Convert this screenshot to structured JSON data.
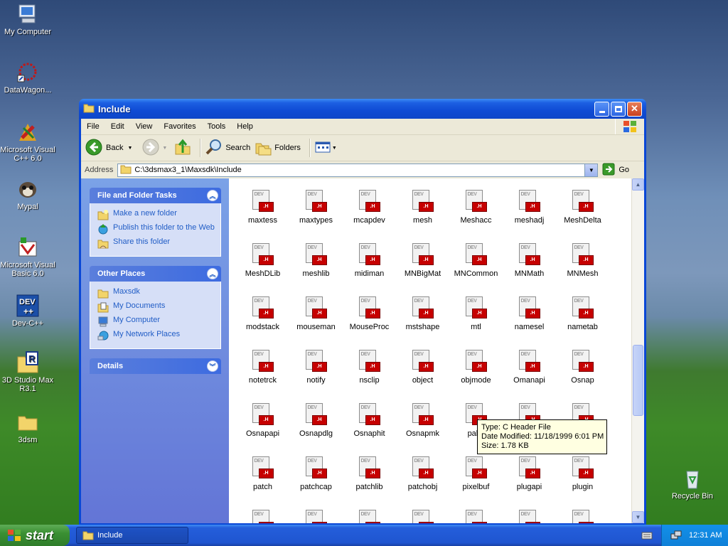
{
  "desktop": {
    "icons": [
      {
        "label": "My Computer"
      },
      {
        "label": "DataWagon..."
      },
      {
        "label": "Microsoft Visual C++ 6.0"
      },
      {
        "label": "Mypal"
      },
      {
        "label": "Microsoft Visual Basic 6.0"
      },
      {
        "label": "Dev-C++"
      },
      {
        "label": "3D Studio Max R3.1"
      },
      {
        "label": "3dsm"
      },
      {
        "label": "Recycle Bin"
      }
    ]
  },
  "window": {
    "title": "Include",
    "menu": [
      "File",
      "Edit",
      "View",
      "Favorites",
      "Tools",
      "Help"
    ],
    "toolbar": {
      "back": "Back",
      "search": "Search",
      "folders": "Folders"
    },
    "address": {
      "label": "Address",
      "path": "C:\\3dsmax3_1\\Maxsdk\\Include",
      "go": "Go"
    },
    "tasks": {
      "file_folder_tasks": {
        "title": "File and Folder Tasks",
        "items": [
          "Make a new folder",
          "Publish this folder to the Web",
          "Share this folder"
        ]
      },
      "other_places": {
        "title": "Other Places",
        "items": [
          "Maxsdk",
          "My Documents",
          "My Computer",
          "My Network Places"
        ]
      },
      "details": {
        "title": "Details"
      }
    },
    "files": [
      "maxtess",
      "maxtypes",
      "mcapdev",
      "mesh",
      "Meshacc",
      "meshadj",
      "MeshDelta",
      "MeshDLib",
      "meshlib",
      "midiman",
      "MNBigMat",
      "MNCommon",
      "MNMath",
      "MNMesh",
      "modstack",
      "mouseman",
      "MouseProc",
      "mstshape",
      "mtl",
      "namesel",
      "nametab",
      "notetrck",
      "notify",
      "nsclip",
      "object",
      "objmode",
      "Omanapi",
      "Osnap",
      "Osnapapi",
      "Osnapdlg",
      "Osnaphit",
      "Osnapmk",
      "palut",
      "",
      "",
      "patch",
      "patchcap",
      "patchlib",
      "patchobj",
      "pixelbuf",
      "plugapi",
      "plugin"
    ],
    "tooltip": {
      "type": "Type: C Header File",
      "date": "Date Modified: 11/18/1999 6:01 PM",
      "size": "Size: 1.78 KB"
    }
  },
  "taskbar": {
    "start": "start",
    "task": "Include",
    "clock": "12:31 AM"
  },
  "colors": {
    "accent": "#0a47d6",
    "taskpane": "#7ba2e7",
    "link": "#215dc6"
  }
}
